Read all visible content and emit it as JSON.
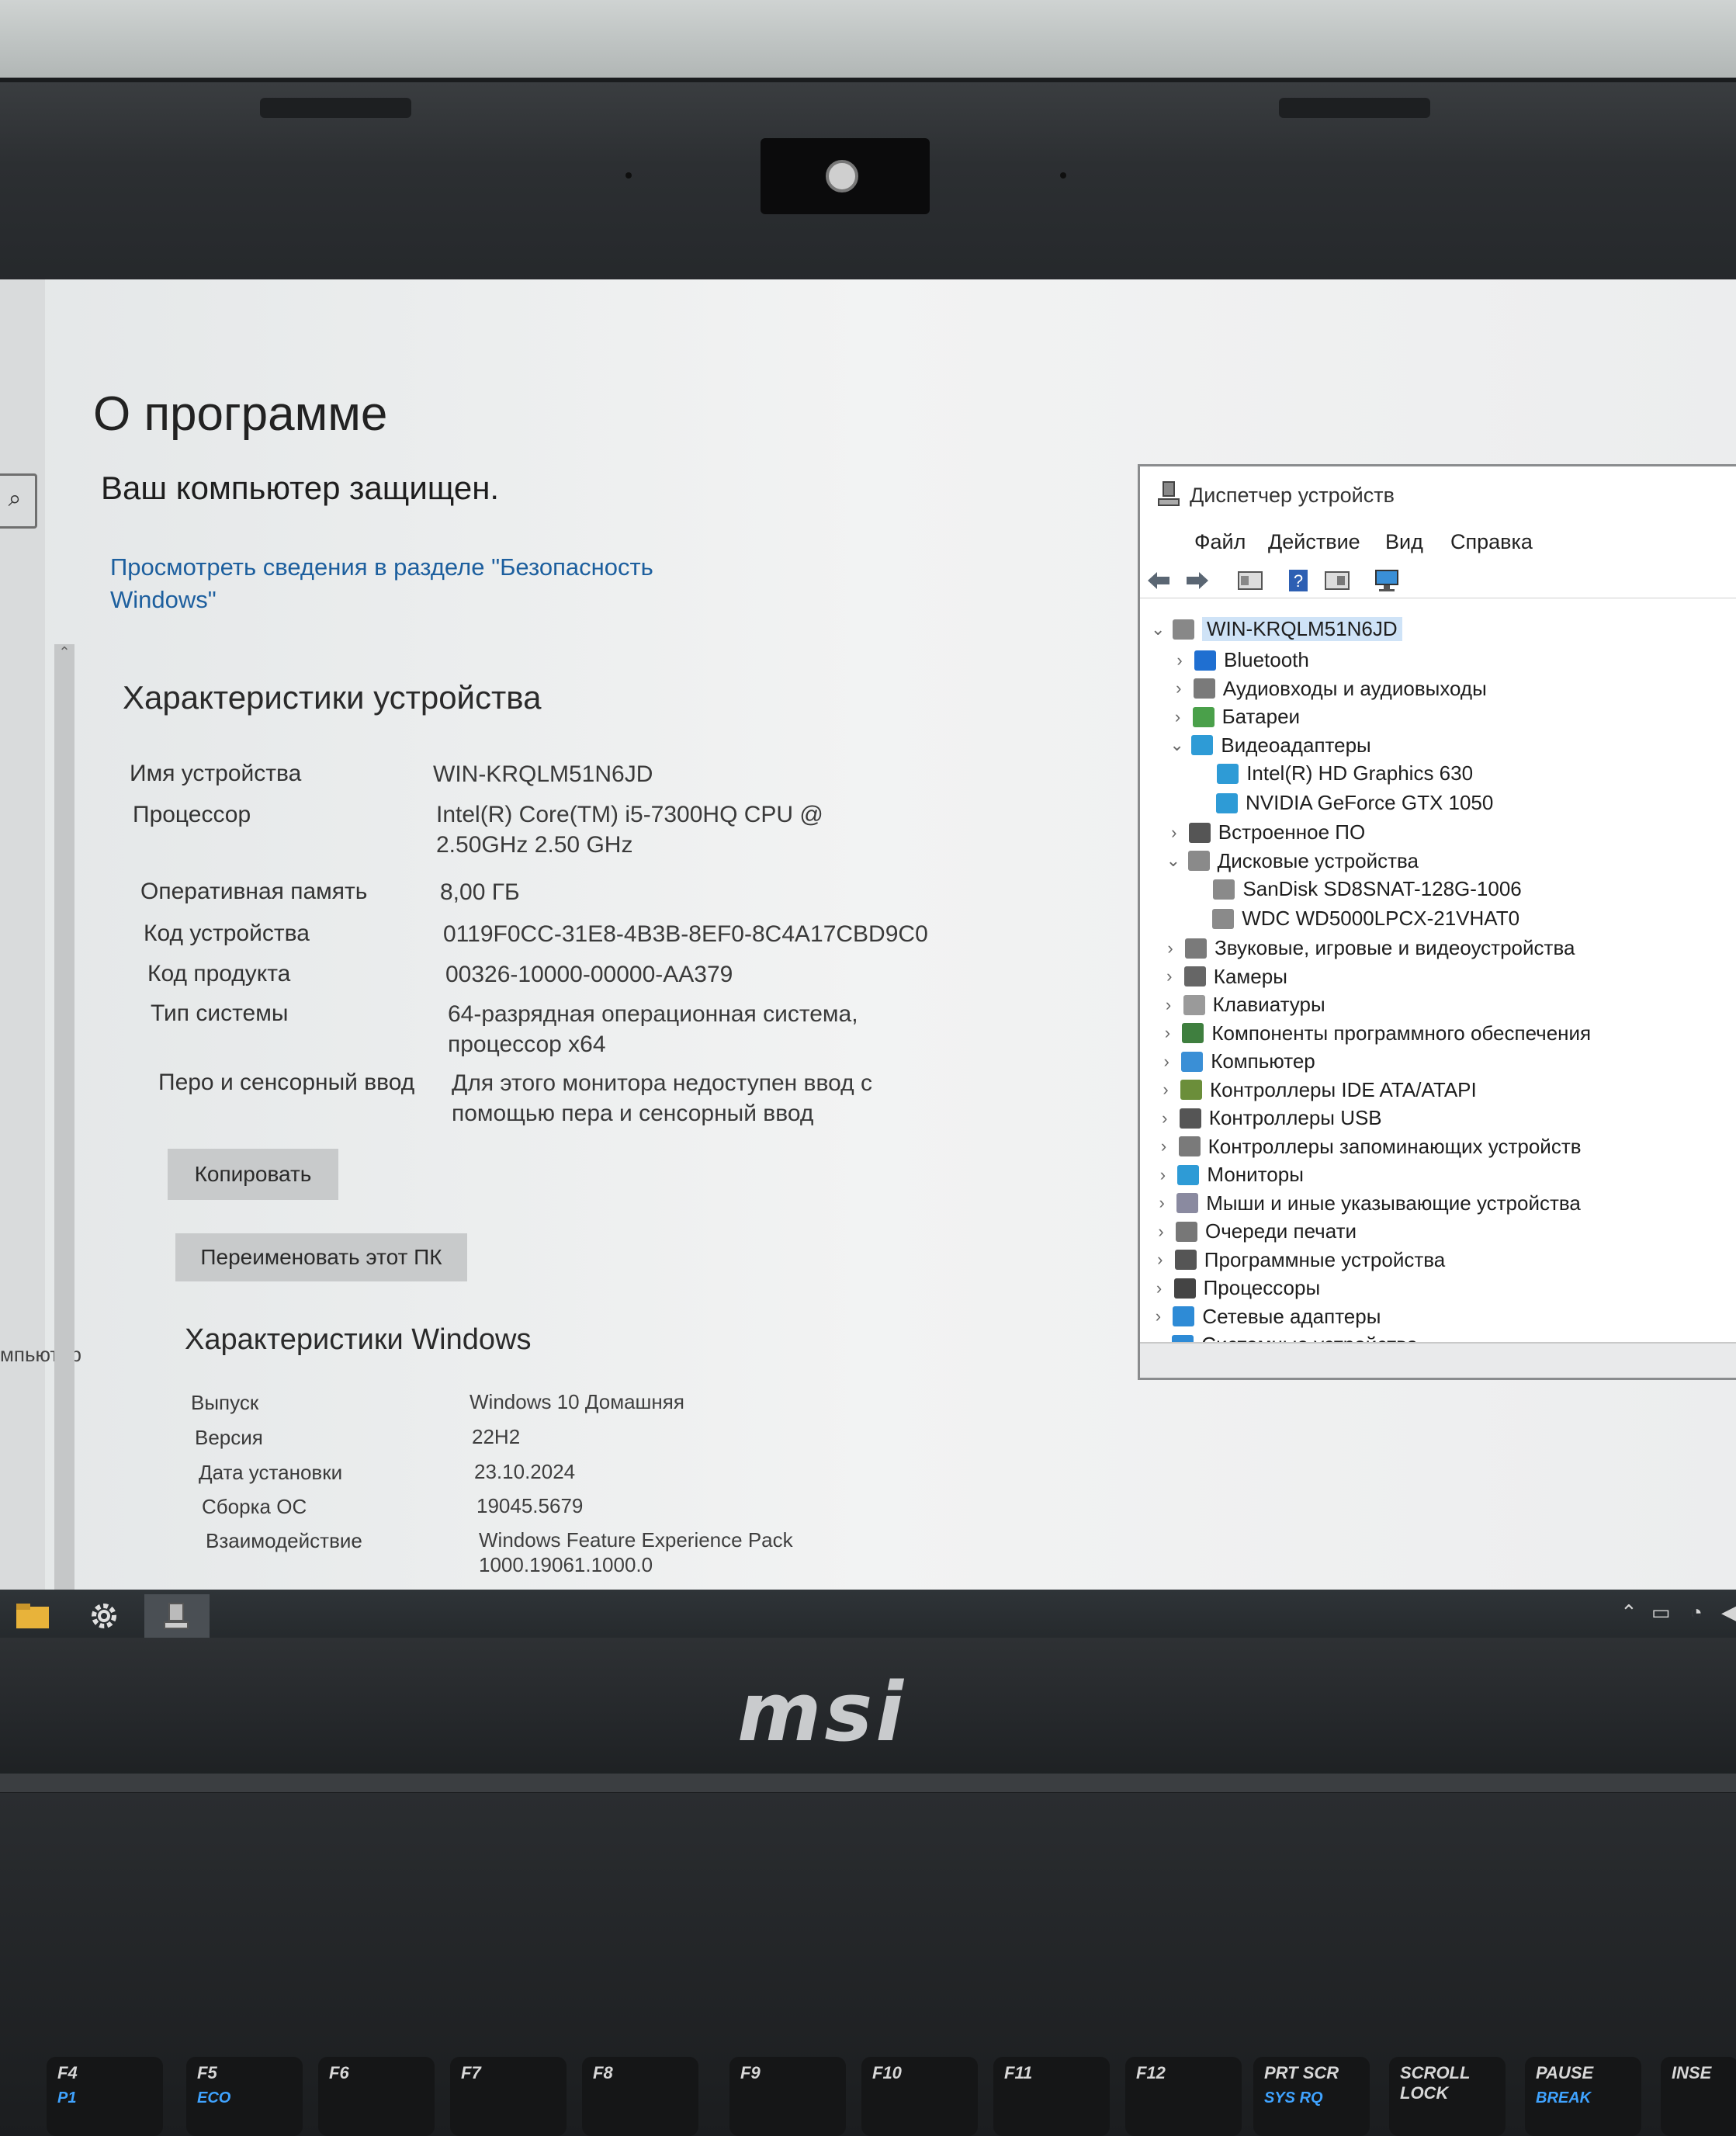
{
  "window": {
    "page_title": "О программе",
    "protected_text": "Ваш компьютер защищен.",
    "security_link": "Просмотреть сведения в разделе \"Безопасность Windows\"",
    "side_label": "мпьютер"
  },
  "device_specs": {
    "heading": "Характеристики устройства",
    "rows": [
      {
        "label": "Имя устройства",
        "value": "WIN-KRQLM51N6JD"
      },
      {
        "label": "Процессор",
        "value": "Intel(R) Core(TM) i5-7300HQ CPU @ 2.50GHz   2.50 GHz"
      },
      {
        "label": "Оперативная память",
        "value": "8,00 ГБ"
      },
      {
        "label": "Код устройства",
        "value": "0119F0CC-31E8-4B3B-8EF0-8C4A17CBD9C0"
      },
      {
        "label": "Код продукта",
        "value": "00326-10000-00000-AA379"
      },
      {
        "label": "Тип системы",
        "value": "64-разрядная операционная система, процессор x64"
      },
      {
        "label": "Перо и сенсорный ввод",
        "value": "Для этого монитора недоступен ввод с помощью пера и сенсорный ввод"
      }
    ],
    "copy_button": "Копировать",
    "rename_button": "Переименовать этот ПК"
  },
  "windows_specs": {
    "heading": "Характеристики Windows",
    "rows": [
      {
        "label": "Выпуск",
        "value": "Windows 10 Домашняя"
      },
      {
        "label": "Версия",
        "value": "22H2"
      },
      {
        "label": "Дата установки",
        "value": "23.10.2024"
      },
      {
        "label": "Сборка ОС",
        "value": "19045.5679"
      },
      {
        "label": "Взаимодействие",
        "value": "Windows Feature Experience Pack 1000.19061.1000.0"
      }
    ]
  },
  "device_manager": {
    "title": "Диспетчер устройств",
    "menu": [
      "Файл",
      "Действие",
      "Вид",
      "Справка"
    ],
    "root": "WIN-KRQLM51N6JD",
    "nodes": [
      {
        "label": "Bluetooth",
        "expanded": false,
        "icon": "bluetooth-icon"
      },
      {
        "label": "Аудиовходы и аудиовыходы",
        "expanded": false,
        "icon": "speaker-icon"
      },
      {
        "label": "Батареи",
        "expanded": false,
        "icon": "battery-icon"
      },
      {
        "label": "Видеоадаптеры",
        "expanded": true,
        "icon": "monitor-icon"
      },
      {
        "label": "Intel(R) HD Graphics 630",
        "child": true,
        "icon": "monitor-icon"
      },
      {
        "label": "NVIDIA GeForce GTX 1050",
        "child": true,
        "icon": "monitor-icon"
      },
      {
        "label": "Встроенное ПО",
        "expanded": false,
        "icon": "chip-icon"
      },
      {
        "label": "Дисковые устройства",
        "expanded": true,
        "icon": "disk-icon"
      },
      {
        "label": "SanDisk SD8SNAT-128G-1006",
        "child": true,
        "icon": "disk-icon"
      },
      {
        "label": "WDC WD5000LPCX-21VHAT0",
        "child": true,
        "icon": "disk-icon"
      },
      {
        "label": "Звуковые, игровые и видеоустройства",
        "expanded": false,
        "icon": "speaker-icon"
      },
      {
        "label": "Камеры",
        "expanded": false,
        "icon": "camera-icon"
      },
      {
        "label": "Клавиатуры",
        "expanded": false,
        "icon": "keyboard-icon"
      },
      {
        "label": "Компоненты программного обеспечения",
        "expanded": false,
        "icon": "component-icon"
      },
      {
        "label": "Компьютер",
        "expanded": false,
        "icon": "computer-icon"
      },
      {
        "label": "Контроллеры IDE ATA/ATAPI",
        "expanded": false,
        "icon": "controller-icon"
      },
      {
        "label": "Контроллеры USB",
        "expanded": false,
        "icon": "usb-icon"
      },
      {
        "label": "Контроллеры запоминающих устройств",
        "expanded": false,
        "icon": "storage-icon"
      },
      {
        "label": "Мониторы",
        "expanded": false,
        "icon": "monitor-icon"
      },
      {
        "label": "Мыши и иные указывающие устройства",
        "expanded": false,
        "icon": "mouse-icon"
      },
      {
        "label": "Очереди печати",
        "expanded": false,
        "icon": "printer-icon"
      },
      {
        "label": "Программные устройства",
        "expanded": false,
        "icon": "software-icon"
      },
      {
        "label": "Процессоры",
        "expanded": false,
        "icon": "cpu-icon"
      },
      {
        "label": "Сетевые адаптеры",
        "expanded": false,
        "icon": "network-icon"
      },
      {
        "label": "Системные устройства",
        "expanded": false,
        "icon": "system-icon"
      }
    ]
  },
  "brand": {
    "logo_text": "msi"
  },
  "keyboard": {
    "keys": [
      {
        "label": "F4",
        "sub": "P1"
      },
      {
        "label": "F5",
        "sub": "ECO"
      },
      {
        "label": "F6",
        "sub": ""
      },
      {
        "label": "F7",
        "sub": ""
      },
      {
        "label": "F8",
        "sub": ""
      },
      {
        "label": "F9",
        "sub": ""
      },
      {
        "label": "F10",
        "sub": ""
      },
      {
        "label": "F11",
        "sub": ""
      },
      {
        "label": "F12",
        "sub": ""
      },
      {
        "label": "PRT SCR",
        "sub": "SYS RQ"
      },
      {
        "label": "SCROLL LOCK",
        "sub": ""
      },
      {
        "label": "PAUSE",
        "sub": "BREAK"
      },
      {
        "label": "INSE",
        "sub": ""
      }
    ]
  }
}
